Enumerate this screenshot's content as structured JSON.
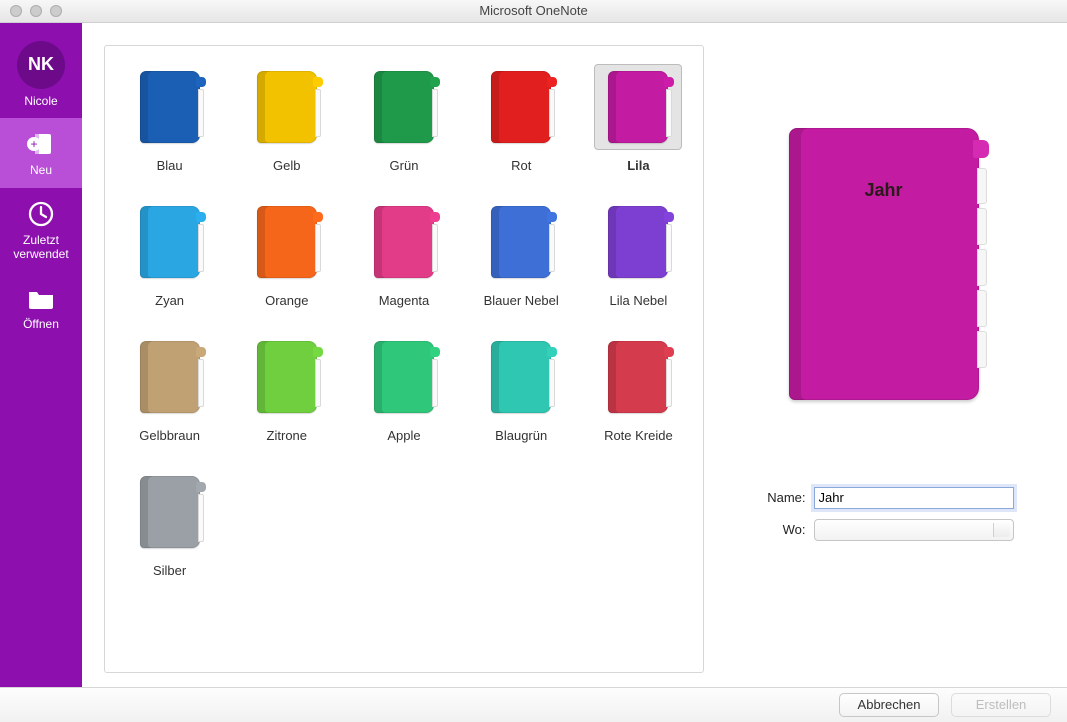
{
  "window": {
    "title": "Microsoft OneNote"
  },
  "sidebar": {
    "avatar_initials": "NK",
    "user_name": "Nicole",
    "items": [
      {
        "key": "new",
        "label": "Neu",
        "selected": true
      },
      {
        "key": "recent",
        "label": "Zuletzt verwendet",
        "selected": false
      },
      {
        "key": "open",
        "label": "Öffnen",
        "selected": false
      }
    ]
  },
  "colors": [
    {
      "label": "Blau",
      "hex": "#1b5fb4",
      "selected": false
    },
    {
      "label": "Gelb",
      "hex": "#f2c200",
      "selected": false
    },
    {
      "label": "Grün",
      "hex": "#1f9a4a",
      "selected": false
    },
    {
      "label": "Rot",
      "hex": "#e21f1f",
      "selected": false
    },
    {
      "label": "Lila",
      "hex": "#c31ba1",
      "selected": true
    },
    {
      "label": "Zyan",
      "hex": "#2aa7e3",
      "selected": false
    },
    {
      "label": "Orange",
      "hex": "#f5661b",
      "selected": false
    },
    {
      "label": "Magenta",
      "hex": "#e23b88",
      "selected": false
    },
    {
      "label": "Blauer Nebel",
      "hex": "#3d6fd6",
      "selected": false
    },
    {
      "label": "Lila Nebel",
      "hex": "#7d3fd1",
      "selected": false
    },
    {
      "label": "Gelbbraun",
      "hex": "#c0a173",
      "selected": false
    },
    {
      "label": "Zitrone",
      "hex": "#6fcf3f",
      "selected": false
    },
    {
      "label": "Apple",
      "hex": "#2fc77a",
      "selected": false
    },
    {
      "label": "Blaugrün",
      "hex": "#2fc7b1",
      "selected": false
    },
    {
      "label": "Rote Kreide",
      "hex": "#d43b4c",
      "selected": false
    },
    {
      "label": "Silber",
      "hex": "#9aa0a6",
      "selected": false
    }
  ],
  "preview": {
    "title": "Jahr",
    "hex": "#c31ba1"
  },
  "form": {
    "name_label": "Name:",
    "name_value": "Jahr",
    "where_label": "Wo:",
    "where_value": ""
  },
  "footer": {
    "cancel": "Abbrechen",
    "create": "Erstellen",
    "create_enabled": false
  }
}
